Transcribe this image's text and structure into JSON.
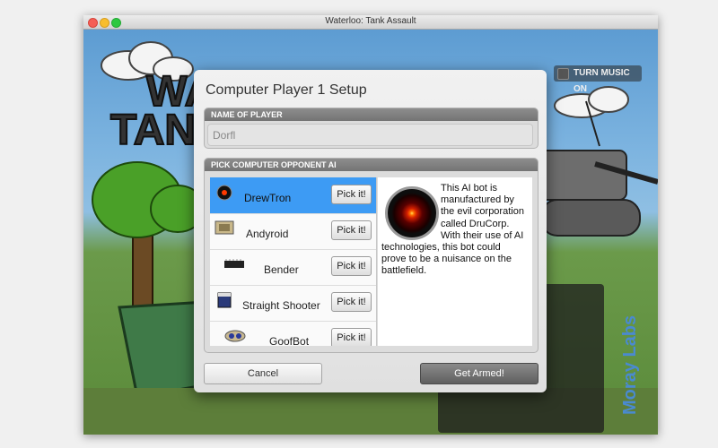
{
  "window": {
    "title": "Waterloo: Tank Assault"
  },
  "game": {
    "logo_text": "WATERLOO: TANK",
    "music_toggle_label": "TURN MUSIC ON",
    "brand": "Moray Labs"
  },
  "dialog": {
    "title": "Computer Player 1 Setup",
    "name_section_label": "NAME OF PLAYER",
    "player_name_placeholder": "Dorfl",
    "ai_section_label": "PICK COMPUTER OPPONENT AI",
    "pick_label": "Pick it!",
    "bots": [
      {
        "name": "DrewTron",
        "icon": "red-eye-icon",
        "selected": true
      },
      {
        "name": "Andyroid",
        "icon": "computer-icon",
        "selected": false
      },
      {
        "name": "Bender",
        "icon": "chip-icon",
        "selected": false
      },
      {
        "name": "Straight Shooter",
        "icon": "battery-icon",
        "selected": false
      },
      {
        "name": "GoofBot",
        "icon": "goggles-icon",
        "selected": false
      }
    ],
    "description": "This AI bot is manufactured by the evil corporation called DruCorp. With their use of AI technologies, this bot could prove to be a nuisance on the battlefield.",
    "cancel_label": "Cancel",
    "confirm_label": "Get Armed!"
  },
  "colors": {
    "selection": "#3d9bf4",
    "accent": "#d21e00"
  }
}
